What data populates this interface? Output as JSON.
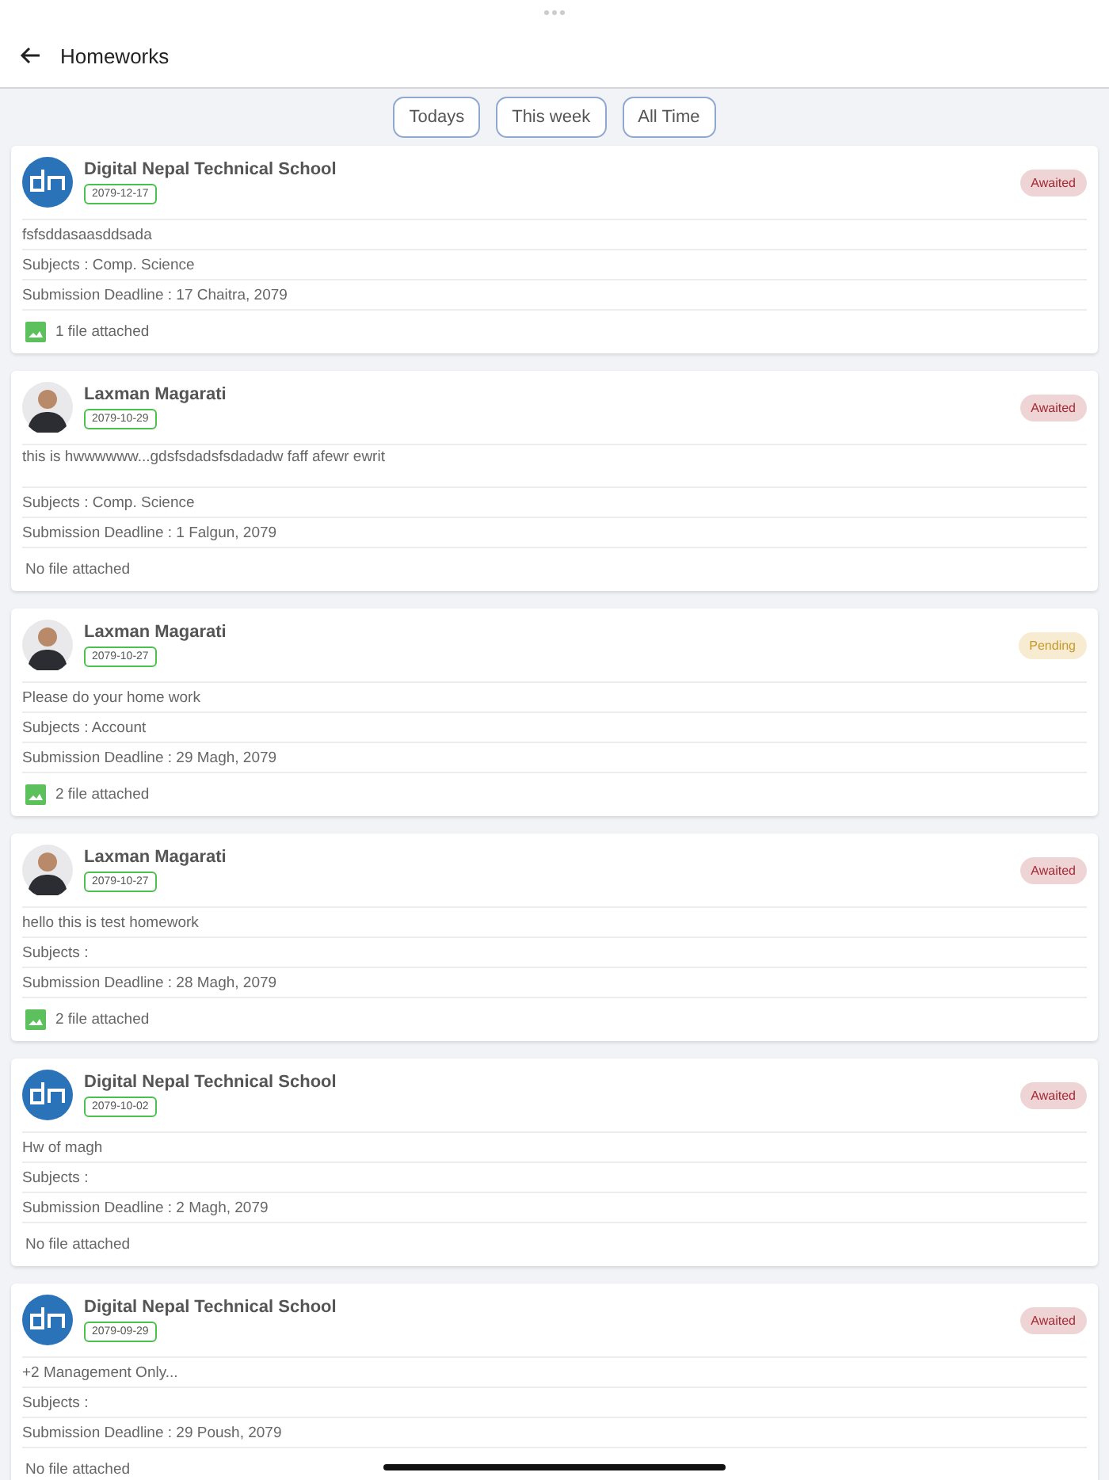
{
  "header": {
    "title": "Homeworks"
  },
  "filters": [
    {
      "label": "Todays",
      "selected": false
    },
    {
      "label": "This week",
      "selected": false
    },
    {
      "label": "All Time",
      "selected": false
    }
  ],
  "homeworks": [
    {
      "avatar": {
        "kind": "logo"
      },
      "author": "Digital Nepal Technical School",
      "date": "2079-12-17",
      "status": {
        "kind": "awaited",
        "label": "Awaited"
      },
      "description": "fsfsddasaasddsada",
      "subjects_label": "Subjects :",
      "subjects": "Comp. Science",
      "deadline_label": "Submission Deadline :",
      "deadline": "17 Chaitra, 2079",
      "attachment": {
        "has_files": true,
        "text": "1 file attached"
      }
    },
    {
      "avatar": {
        "kind": "person"
      },
      "author": "Laxman Magarati",
      "date": "2079-10-29",
      "status": {
        "kind": "awaited",
        "label": "Awaited"
      },
      "description": "this is hwwwwww...gdsfsdadsfsdadadw faff afewr ewrit\n ",
      "subjects_label": "Subjects :",
      "subjects": "Comp. Science",
      "deadline_label": "Submission Deadline :",
      "deadline": "1 Falgun, 2079",
      "attachment": {
        "has_files": false,
        "text": "No file attached"
      }
    },
    {
      "avatar": {
        "kind": "person"
      },
      "author": "Laxman Magarati",
      "date": "2079-10-27",
      "status": {
        "kind": "pending",
        "label": "Pending"
      },
      "description": "Please do your home work",
      "subjects_label": "Subjects :",
      "subjects": "Account",
      "deadline_label": "Submission Deadline :",
      "deadline": "29 Magh, 2079",
      "attachment": {
        "has_files": true,
        "text": "2 file attached"
      }
    },
    {
      "avatar": {
        "kind": "person"
      },
      "author": "Laxman Magarati",
      "date": "2079-10-27",
      "status": {
        "kind": "awaited",
        "label": "Awaited"
      },
      "description": "hello this is test homework",
      "subjects_label": "Subjects :",
      "deadline_label": "Submission Deadline :",
      "deadline": "28 Magh, 2079",
      "attachment": {
        "has_files": true,
        "text": "2 file attached"
      }
    },
    {
      "avatar": {
        "kind": "logo"
      },
      "author": "Digital Nepal Technical School",
      "date": "2079-10-02",
      "status": {
        "kind": "awaited",
        "label": "Awaited"
      },
      "description": "Hw of magh",
      "subjects_label": "Subjects :",
      "deadline_label": "Submission Deadline :",
      "deadline": "2 Magh, 2079",
      "attachment": {
        "has_files": false,
        "text": "No file attached"
      }
    },
    {
      "avatar": {
        "kind": "logo"
      },
      "author": "Digital Nepal Technical School",
      "date": "2079-09-29",
      "status": {
        "kind": "awaited",
        "label": "Awaited"
      },
      "description": "+2 Management Only...",
      "subjects_label": "Subjects :",
      "deadline_label": "Submission Deadline :",
      "deadline": "29 Poush, 2079",
      "attachment": {
        "has_files": false,
        "text": "No file attached"
      }
    }
  ]
}
